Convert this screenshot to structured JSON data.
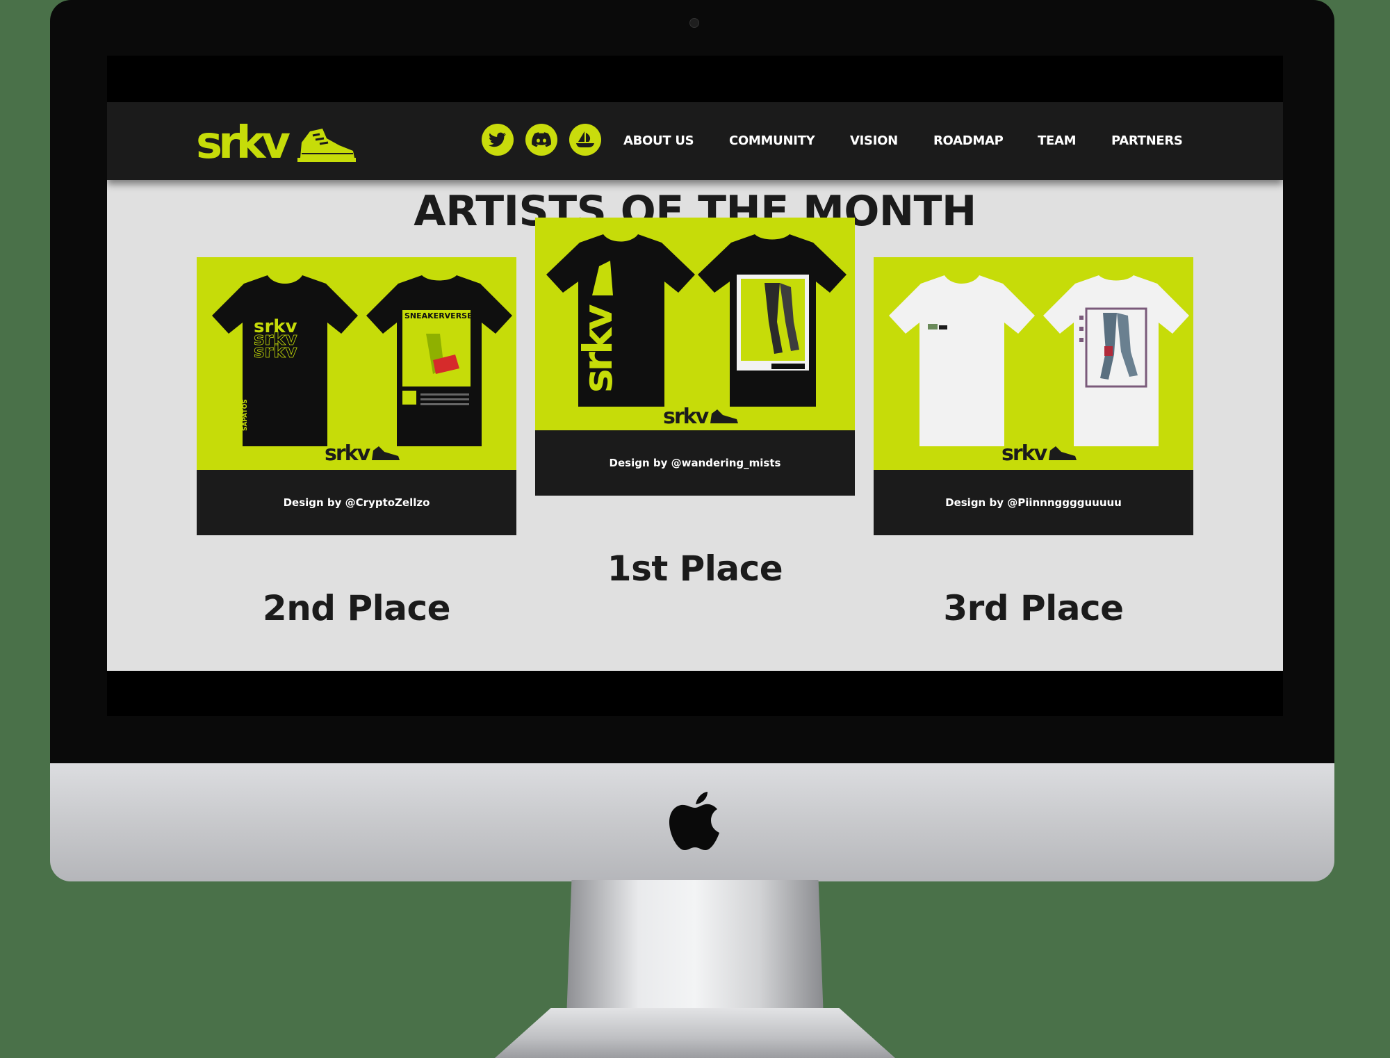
{
  "nav": {
    "logo_text": "srkv",
    "social": [
      {
        "icon": "twitter-icon"
      },
      {
        "icon": "discord-icon"
      },
      {
        "icon": "opensea-icon"
      }
    ],
    "links": [
      "ABOUT US",
      "COMMUNITY",
      "VISION",
      "ROADMAP",
      "TEAM",
      "PARTNERS"
    ]
  },
  "section": {
    "title": "ARTISTS OF THE MONTH"
  },
  "cards": [
    {
      "caption": "Design by @CryptoZellzo",
      "place": "2nd Place",
      "shirt_color": "#0f0f0f",
      "print_text": "SNEAKERVERSE",
      "side_text": "SAPATOS"
    },
    {
      "caption": "Design by @wandering_mists",
      "place": "1st Place",
      "shirt_color": "#0f0f0f"
    },
    {
      "caption": "Design by @Piinnngggguuuuu",
      "place": "3rd Place",
      "shirt_color": "#f2f2f2"
    }
  ],
  "colors": {
    "accent": "#c6dc09",
    "nav_bg": "#1b1b1b",
    "content_bg": "#e0e0e0",
    "text_dark": "#1b1b1b"
  },
  "device": {
    "brand_icon": "apple-logo-icon"
  }
}
